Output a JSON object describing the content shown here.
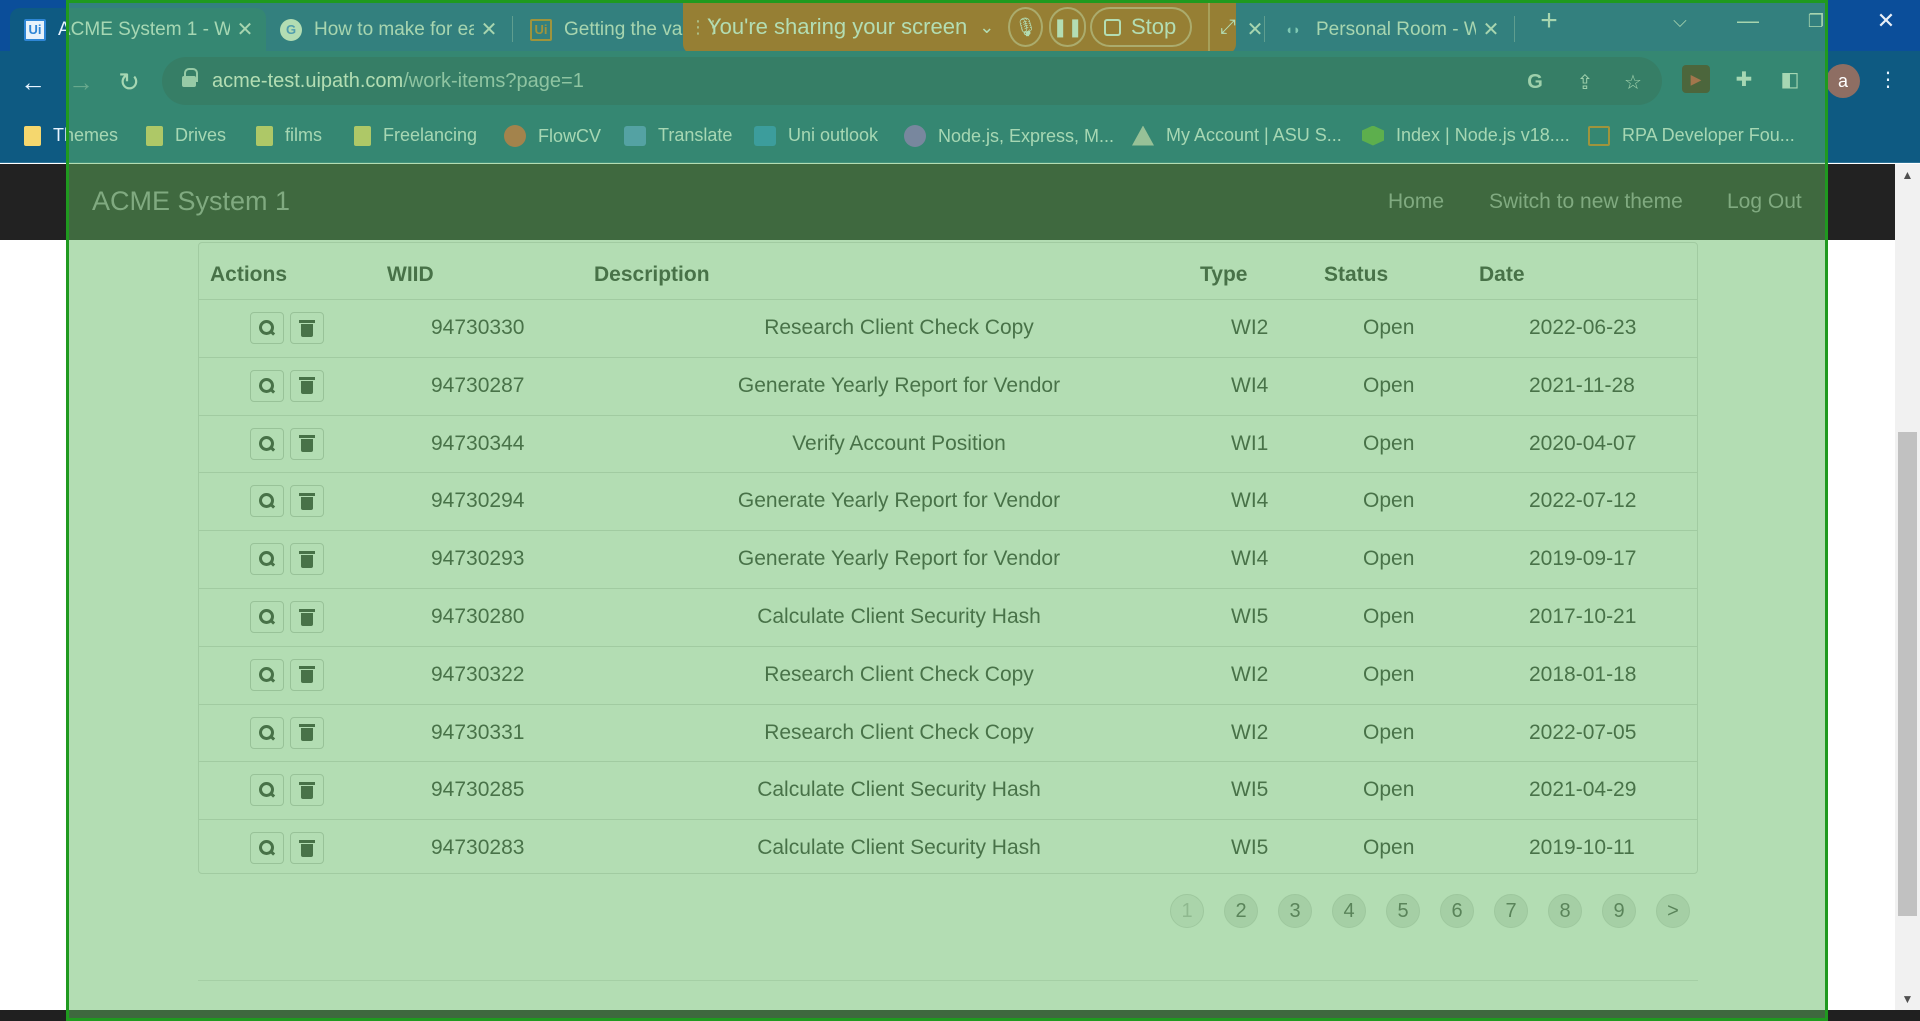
{
  "browser": {
    "tabs": [
      {
        "title": "ACME System 1 - W",
        "favicon": "uipath-logo-icon",
        "active": true
      },
      {
        "title": "How to make for ea",
        "favicon": "google-icon",
        "active": false
      },
      {
        "title": "Getting the val",
        "favicon": "uipath-logo-icon",
        "active": false
      },
      {
        "title": "Personal Room - W",
        "favicon": "webex-icon",
        "active": false
      }
    ],
    "new_tab": "+",
    "url_host": "acme-test.uipath.com",
    "url_path": "/work-items?page=1",
    "profile_initial": "a",
    "bookmarks": [
      {
        "label": "Themes",
        "icon": "folder-icon"
      },
      {
        "label": "Drives",
        "icon": "folder-icon"
      },
      {
        "label": "films",
        "icon": "folder-icon"
      },
      {
        "label": "Freelancing",
        "icon": "folder-icon"
      },
      {
        "label": "FlowCV",
        "icon": "flowcv-icon"
      },
      {
        "label": "Translate",
        "icon": "translate-icon"
      },
      {
        "label": "Uni outlook",
        "icon": "outlook-icon"
      },
      {
        "label": "Node.js, Express, M...",
        "icon": "udemy-icon"
      },
      {
        "label": "My Account | ASU S...",
        "icon": "asu-icon"
      },
      {
        "label": "Index | Node.js v18....",
        "icon": "nodejs-icon"
      },
      {
        "label": "RPA Developer Fou...",
        "icon": "uipath-logo-icon"
      }
    ]
  },
  "share_bar": {
    "text": "You're sharing your screen",
    "stop_label": "Stop"
  },
  "app": {
    "brand": "ACME System 1",
    "nav": [
      "Home",
      "Switch to new theme",
      "Log Out"
    ]
  },
  "table": {
    "headers": [
      "Actions",
      "WIID",
      "Description",
      "Type",
      "Status",
      "Date"
    ],
    "rows": [
      {
        "wiid": "94730330",
        "description": "Research Client Check Copy",
        "type": "WI2",
        "status": "Open",
        "date": "2022-06-23"
      },
      {
        "wiid": "94730287",
        "description": "Generate Yearly Report for Vendor",
        "type": "WI4",
        "status": "Open",
        "date": "2021-11-28"
      },
      {
        "wiid": "94730344",
        "description": "Verify Account Position",
        "type": "WI1",
        "status": "Open",
        "date": "2020-04-07"
      },
      {
        "wiid": "94730294",
        "description": "Generate Yearly Report for Vendor",
        "type": "WI4",
        "status": "Open",
        "date": "2022-07-12"
      },
      {
        "wiid": "94730293",
        "description": "Generate Yearly Report for Vendor",
        "type": "WI4",
        "status": "Open",
        "date": "2019-09-17"
      },
      {
        "wiid": "94730280",
        "description": "Calculate Client Security Hash",
        "type": "WI5",
        "status": "Open",
        "date": "2017-10-21"
      },
      {
        "wiid": "94730322",
        "description": "Research Client Check Copy",
        "type": "WI2",
        "status": "Open",
        "date": "2018-01-18"
      },
      {
        "wiid": "94730331",
        "description": "Research Client Check Copy",
        "type": "WI2",
        "status": "Open",
        "date": "2022-07-05"
      },
      {
        "wiid": "94730285",
        "description": "Calculate Client Security Hash",
        "type": "WI5",
        "status": "Open",
        "date": "2021-04-29"
      },
      {
        "wiid": "94730283",
        "description": "Calculate Client Security Hash",
        "type": "WI5",
        "status": "Open",
        "date": "2019-10-11"
      }
    ]
  },
  "pagination": {
    "pages": [
      "1",
      "2",
      "3",
      "4",
      "5",
      "6",
      "7",
      "8",
      "9",
      ">"
    ],
    "current": "1"
  },
  "colors": {
    "tabstrip": "#0b4e9a",
    "toolbar": "#0e5a82",
    "share_bar": "#c84c0d",
    "navbar": "#222222",
    "share_overlay": "#60b860"
  }
}
